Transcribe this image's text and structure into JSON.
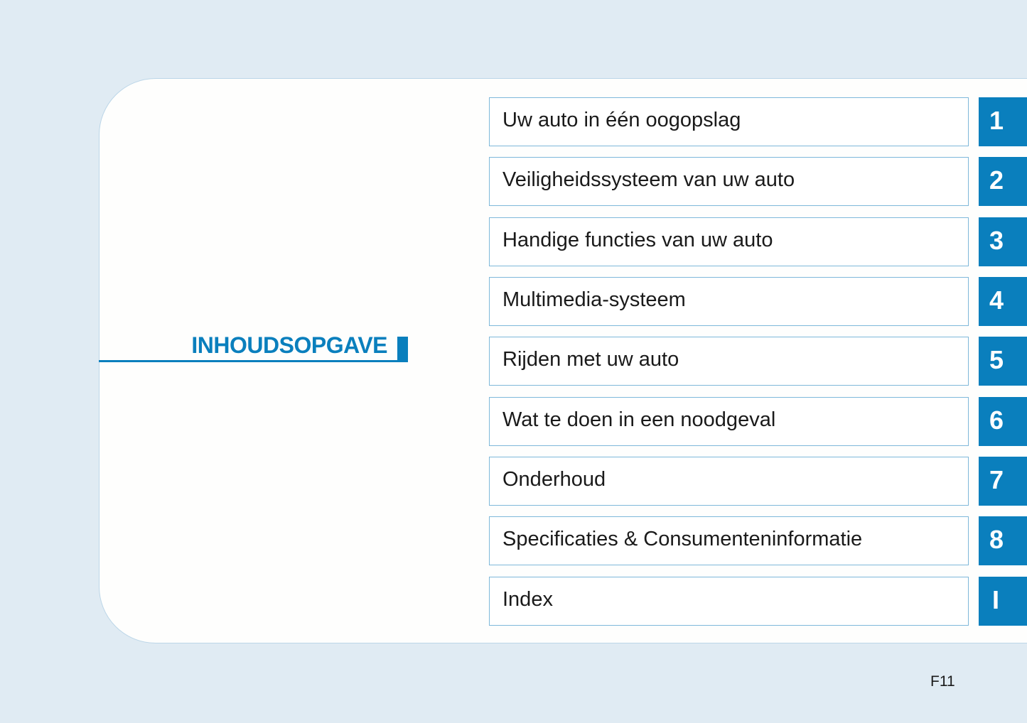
{
  "page": {
    "title": "INHOUDSOPGAVE",
    "footer_code": "F11",
    "accent_color": "#0a7fbd",
    "background_color": "#e0ebf3"
  },
  "toc": [
    {
      "label": "Uw auto in één oogopslag",
      "tab": "1"
    },
    {
      "label": "Veiligheidssysteem van uw auto",
      "tab": "2"
    },
    {
      "label": "Handige functies van uw auto",
      "tab": "3"
    },
    {
      "label": "Multimedia-systeem",
      "tab": "4"
    },
    {
      "label": "Rijden met uw auto",
      "tab": "5"
    },
    {
      "label": "Wat te doen in een noodgeval",
      "tab": "6"
    },
    {
      "label": "Onderhoud",
      "tab": "7"
    },
    {
      "label": "Specificaties & Consumenteninformatie",
      "tab": "8"
    },
    {
      "label": "Index",
      "tab": "I"
    }
  ]
}
